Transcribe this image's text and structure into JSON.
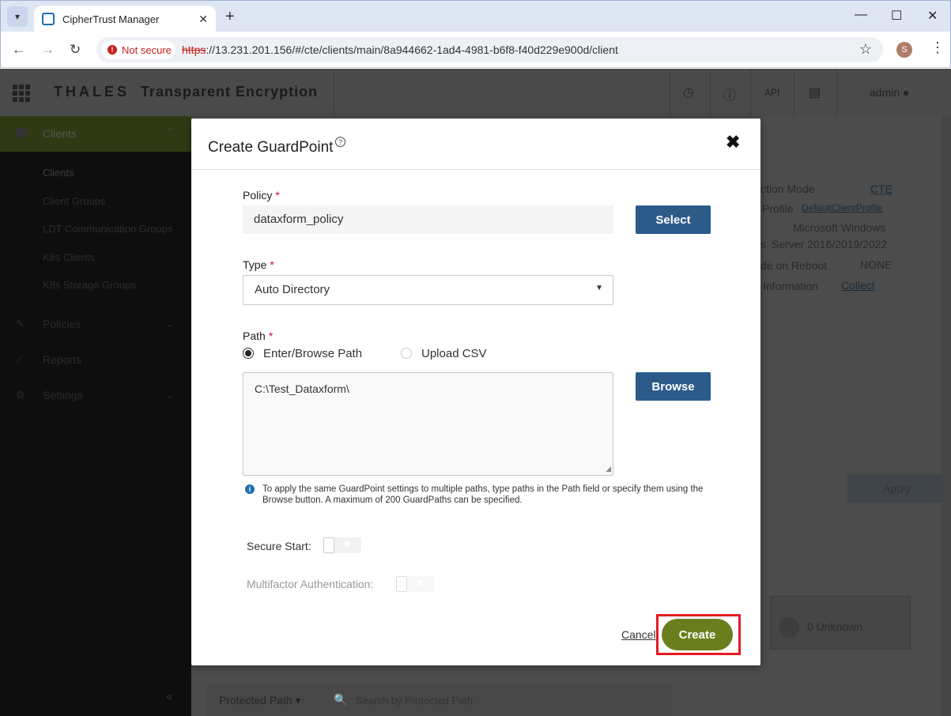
{
  "browser": {
    "tab_title": "CipherTrust Manager",
    "new_tab": "+",
    "security_label": "Not secure",
    "url_scheme": "https",
    "url_rest": "://13.231.201.156/#/cte/clients/main/8a944662-1ad4-4981-b6f8-f40d229e900d/client",
    "profile_initial": "S"
  },
  "header": {
    "brand_logo": "THALES",
    "brand_product": "Transparent Encryption",
    "api_label": "API",
    "user": "admin"
  },
  "sidebar": {
    "section_label": "Clients",
    "items": [
      "Clients",
      "Client Groups",
      "LDT Communication Groups",
      "K8s Clients",
      "K8s Storage Groups"
    ],
    "top_items": [
      "Policies",
      "Reports",
      "Settings"
    ]
  },
  "background": {
    "rows": [
      {
        "label": "ction Mode",
        "value": "CTE"
      },
      {
        "label": "Profile",
        "value": "DefaultClientProfile"
      },
      {
        "label": "",
        "value": "Microsoft Windows"
      },
      {
        "label": "s",
        "value": "Server 2016/2019/2022"
      },
      {
        "label": "de on Reboot",
        "value": "NONE"
      },
      {
        "label": "Information",
        "value": "Collect"
      }
    ],
    "apply_label": "Apply",
    "unknown_label": "0 Unknown",
    "search_select": "Protected Path",
    "search_placeholder": "Search by Protected Path"
  },
  "modal": {
    "title": "Create GuardPoint",
    "help": "?",
    "policy_label": "Policy",
    "policy_value": "dataxform_policy",
    "select_button": "Select",
    "type_label": "Type",
    "type_value": "Auto Directory",
    "path_label": "Path",
    "radio_browse": "Enter/Browse Path",
    "radio_csv": "Upload CSV",
    "path_value": "C:\\Test_Dataxform\\",
    "browse_button": "Browse",
    "info_text": "To apply the same GuardPoint settings to multiple paths, type paths in the Path field or specify them using the Browse button. A maximum of 200 GuardPaths can be specified.",
    "secure_start_label": "Secure Start:",
    "mfa_label": "Multifactor Authentication:",
    "cancel_button": "Cancel",
    "create_button": "Create",
    "required_mark": "*"
  },
  "colors": {
    "create_button": "#6b7e1e",
    "blue_button": "#2c5b8a",
    "highlight": "#e41b23"
  }
}
